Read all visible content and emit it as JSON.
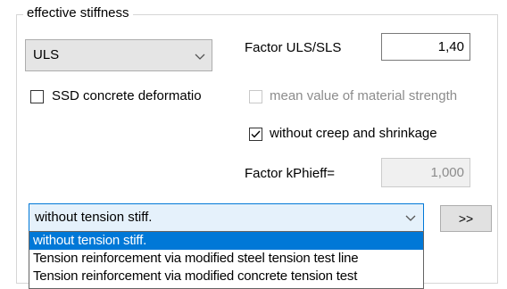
{
  "group": {
    "title": "effective stiffness"
  },
  "limit_state_combo": {
    "value": "ULS"
  },
  "factor_uls_sls": {
    "label": "Factor ULS/SLS",
    "value": "1,40"
  },
  "ssd_checkbox": {
    "label": "SSD concrete deformatio",
    "checked": false
  },
  "mean_value_checkbox": {
    "label": "mean value of material strength",
    "checked": false,
    "enabled": false
  },
  "creep_checkbox": {
    "label": "without creep and shrinkage",
    "checked": true
  },
  "factor_kphieff": {
    "label": "Factor kPhieff=",
    "value": "1,000",
    "enabled": false
  },
  "tension_combo": {
    "value": "without tension stiff.",
    "options": [
      "without tension stiff.",
      "Tension reinforcement via modified steel tension test line",
      "Tension reinforcement via modified concrete tension test"
    ],
    "selected_index": 0
  },
  "more_button": {
    "label": ">>"
  },
  "icons": {
    "combo_arrow": "chevron-down-icon",
    "check": "checkmark-icon"
  },
  "colors": {
    "selection": "#0078d7",
    "focus_border": "#0078d7",
    "disabled_text": "#8c8c8c",
    "group_border": "#d6d6d6"
  }
}
